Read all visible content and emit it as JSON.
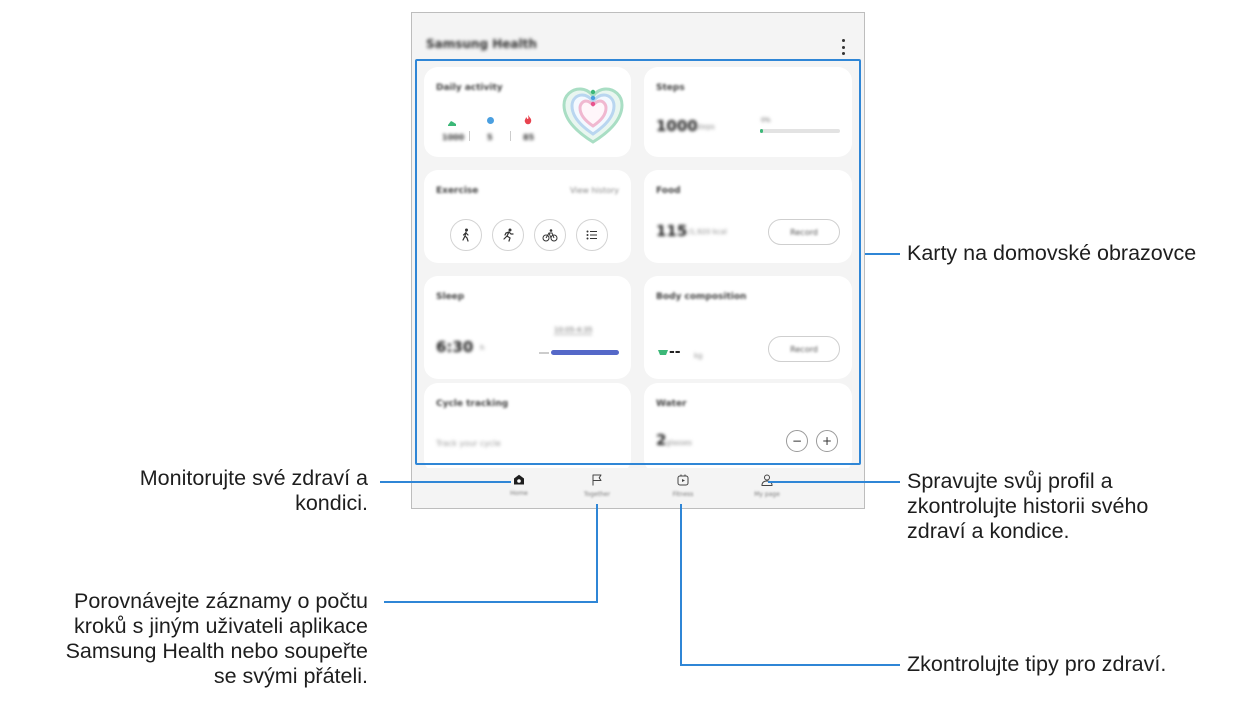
{
  "app": {
    "title": "Samsung Health",
    "more_icon": "more-vertical-icon"
  },
  "cards": {
    "daily_activity": {
      "title": "Daily activity",
      "steps": "1000",
      "active_time": "5",
      "calories": "85",
      "ring_colors": [
        "#4ec38f",
        "#4a9fe0",
        "#e8538d"
      ]
    },
    "steps": {
      "title": "Steps",
      "value": "1000",
      "unit": "steps",
      "goal_label": "0%",
      "progress": 0.02
    },
    "exercise": {
      "title": "Exercise",
      "link": "View history",
      "icons": [
        "walking-icon",
        "running-icon",
        "cycling-icon",
        "list-icon"
      ]
    },
    "food": {
      "title": "Food",
      "value": "115",
      "unit": "/1,920 kcal",
      "button": "Record"
    },
    "sleep": {
      "title": "Sleep",
      "value": "6:30",
      "unit": "h",
      "times_label": "10:05-4:35"
    },
    "body_composition": {
      "title": "Body composition",
      "value": "--",
      "unit": "kg",
      "button": "Record"
    },
    "cycle_tracking": {
      "title": "Cycle tracking",
      "subtitle": "Track your cycle"
    },
    "water": {
      "title": "Water",
      "value": "2",
      "unit": "glasses"
    }
  },
  "nav": {
    "items": [
      {
        "label": "Home",
        "icon": "home-icon"
      },
      {
        "label": "Together",
        "icon": "flag-icon"
      },
      {
        "label": "Fitness",
        "icon": "fitness-video-icon"
      },
      {
        "label": "My page",
        "icon": "person-icon"
      }
    ]
  },
  "annotations": {
    "home_cards": "Karty na domovské obrazovce",
    "home_line1": "Monitorujte své zdraví a",
    "home_line2": "kondici.",
    "together_line1": "Porovnávejte záznamy o počtu",
    "together_line2": "kroků s jiným uživateli aplikace",
    "together_line3": "Samsung Health nebo soupeřte",
    "together_line4": "se svými přáteli.",
    "mypage_line1": "Spravujte svůj profil a",
    "mypage_line2": "zkontrolujte historii svého",
    "mypage_line3": "zdraví a kondice.",
    "fitness": "Zkontrolujte tipy pro zdraví."
  },
  "colors": {
    "callout_line": "#2f86d6",
    "sleep_bar": "#5568c8",
    "green": "#3cb878",
    "blue": "#4a9fe0",
    "red": "#e8434f"
  }
}
